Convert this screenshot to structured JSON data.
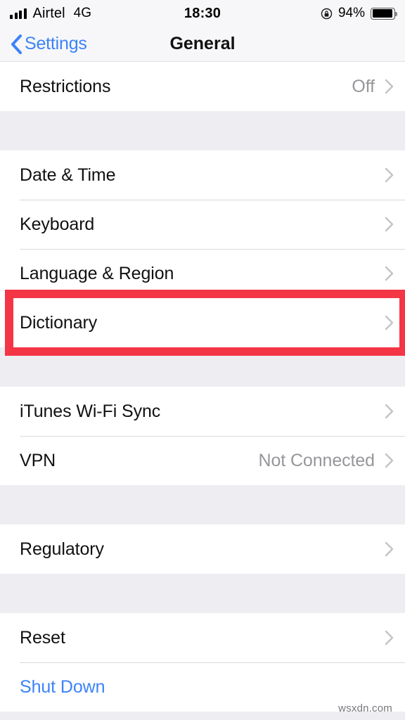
{
  "status_bar": {
    "carrier": "Airtel",
    "network": "4G",
    "time": "18:30",
    "battery_percent": "94%",
    "signal_bars": 4,
    "rotation_lock_icon": "rotation-lock-icon"
  },
  "nav_bar": {
    "back_label": "Settings",
    "back_icon": "chevron-left-icon",
    "title": "General"
  },
  "colors": {
    "accent_blue": "#3c83f7",
    "highlight_red": "#f43545",
    "background_gray": "#eeeef2",
    "value_gray": "#96969b"
  },
  "sections": [
    {
      "rows": [
        {
          "label": "Restrictions",
          "value": "Off",
          "chevron": true,
          "highlighted": false,
          "link": false
        }
      ]
    },
    {
      "rows": [
        {
          "label": "Date & Time",
          "value": "",
          "chevron": true,
          "highlighted": false,
          "link": false
        },
        {
          "label": "Keyboard",
          "value": "",
          "chevron": true,
          "highlighted": false,
          "link": false
        },
        {
          "label": "Language & Region",
          "value": "",
          "chevron": true,
          "highlighted": false,
          "link": false
        },
        {
          "label": "Dictionary",
          "value": "",
          "chevron": true,
          "highlighted": true,
          "link": false
        }
      ]
    },
    {
      "rows": [
        {
          "label": "iTunes Wi-Fi Sync",
          "value": "",
          "chevron": true,
          "highlighted": false,
          "link": false
        },
        {
          "label": "VPN",
          "value": "Not Connected",
          "chevron": true,
          "highlighted": false,
          "link": false
        }
      ]
    },
    {
      "rows": [
        {
          "label": "Regulatory",
          "value": "",
          "chevron": true,
          "highlighted": false,
          "link": false
        }
      ]
    },
    {
      "rows": [
        {
          "label": "Reset",
          "value": "",
          "chevron": true,
          "highlighted": false,
          "link": false
        },
        {
          "label": "Shut Down",
          "value": "",
          "chevron": false,
          "highlighted": false,
          "link": true
        }
      ]
    }
  ],
  "watermark": "wsxdn.com"
}
